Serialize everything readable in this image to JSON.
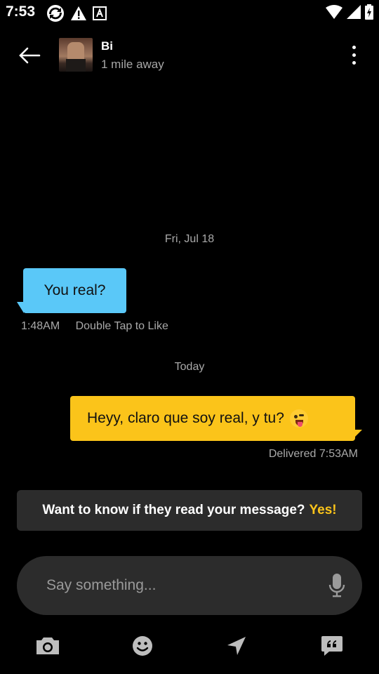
{
  "status_bar": {
    "time": "7:53"
  },
  "header": {
    "name": "Bi",
    "distance": "1 mile away"
  },
  "conversation": {
    "date_1": "Fri, Jul 18",
    "incoming": {
      "text": "You real?",
      "time": "1:48AM",
      "like_hint": "Double Tap to Like"
    },
    "date_2": "Today",
    "outgoing": {
      "text": "Heyy, claro que soy real, y tu?",
      "status": "Delivered 7:53AM"
    }
  },
  "read_banner": {
    "question": "Want to know if they read your message?",
    "cta": "Yes!"
  },
  "composer": {
    "placeholder": "Say something..."
  },
  "colors": {
    "incoming_bubble": "#5ac8f8",
    "outgoing_bubble": "#fbc41a",
    "accent": "#fbc41a"
  }
}
